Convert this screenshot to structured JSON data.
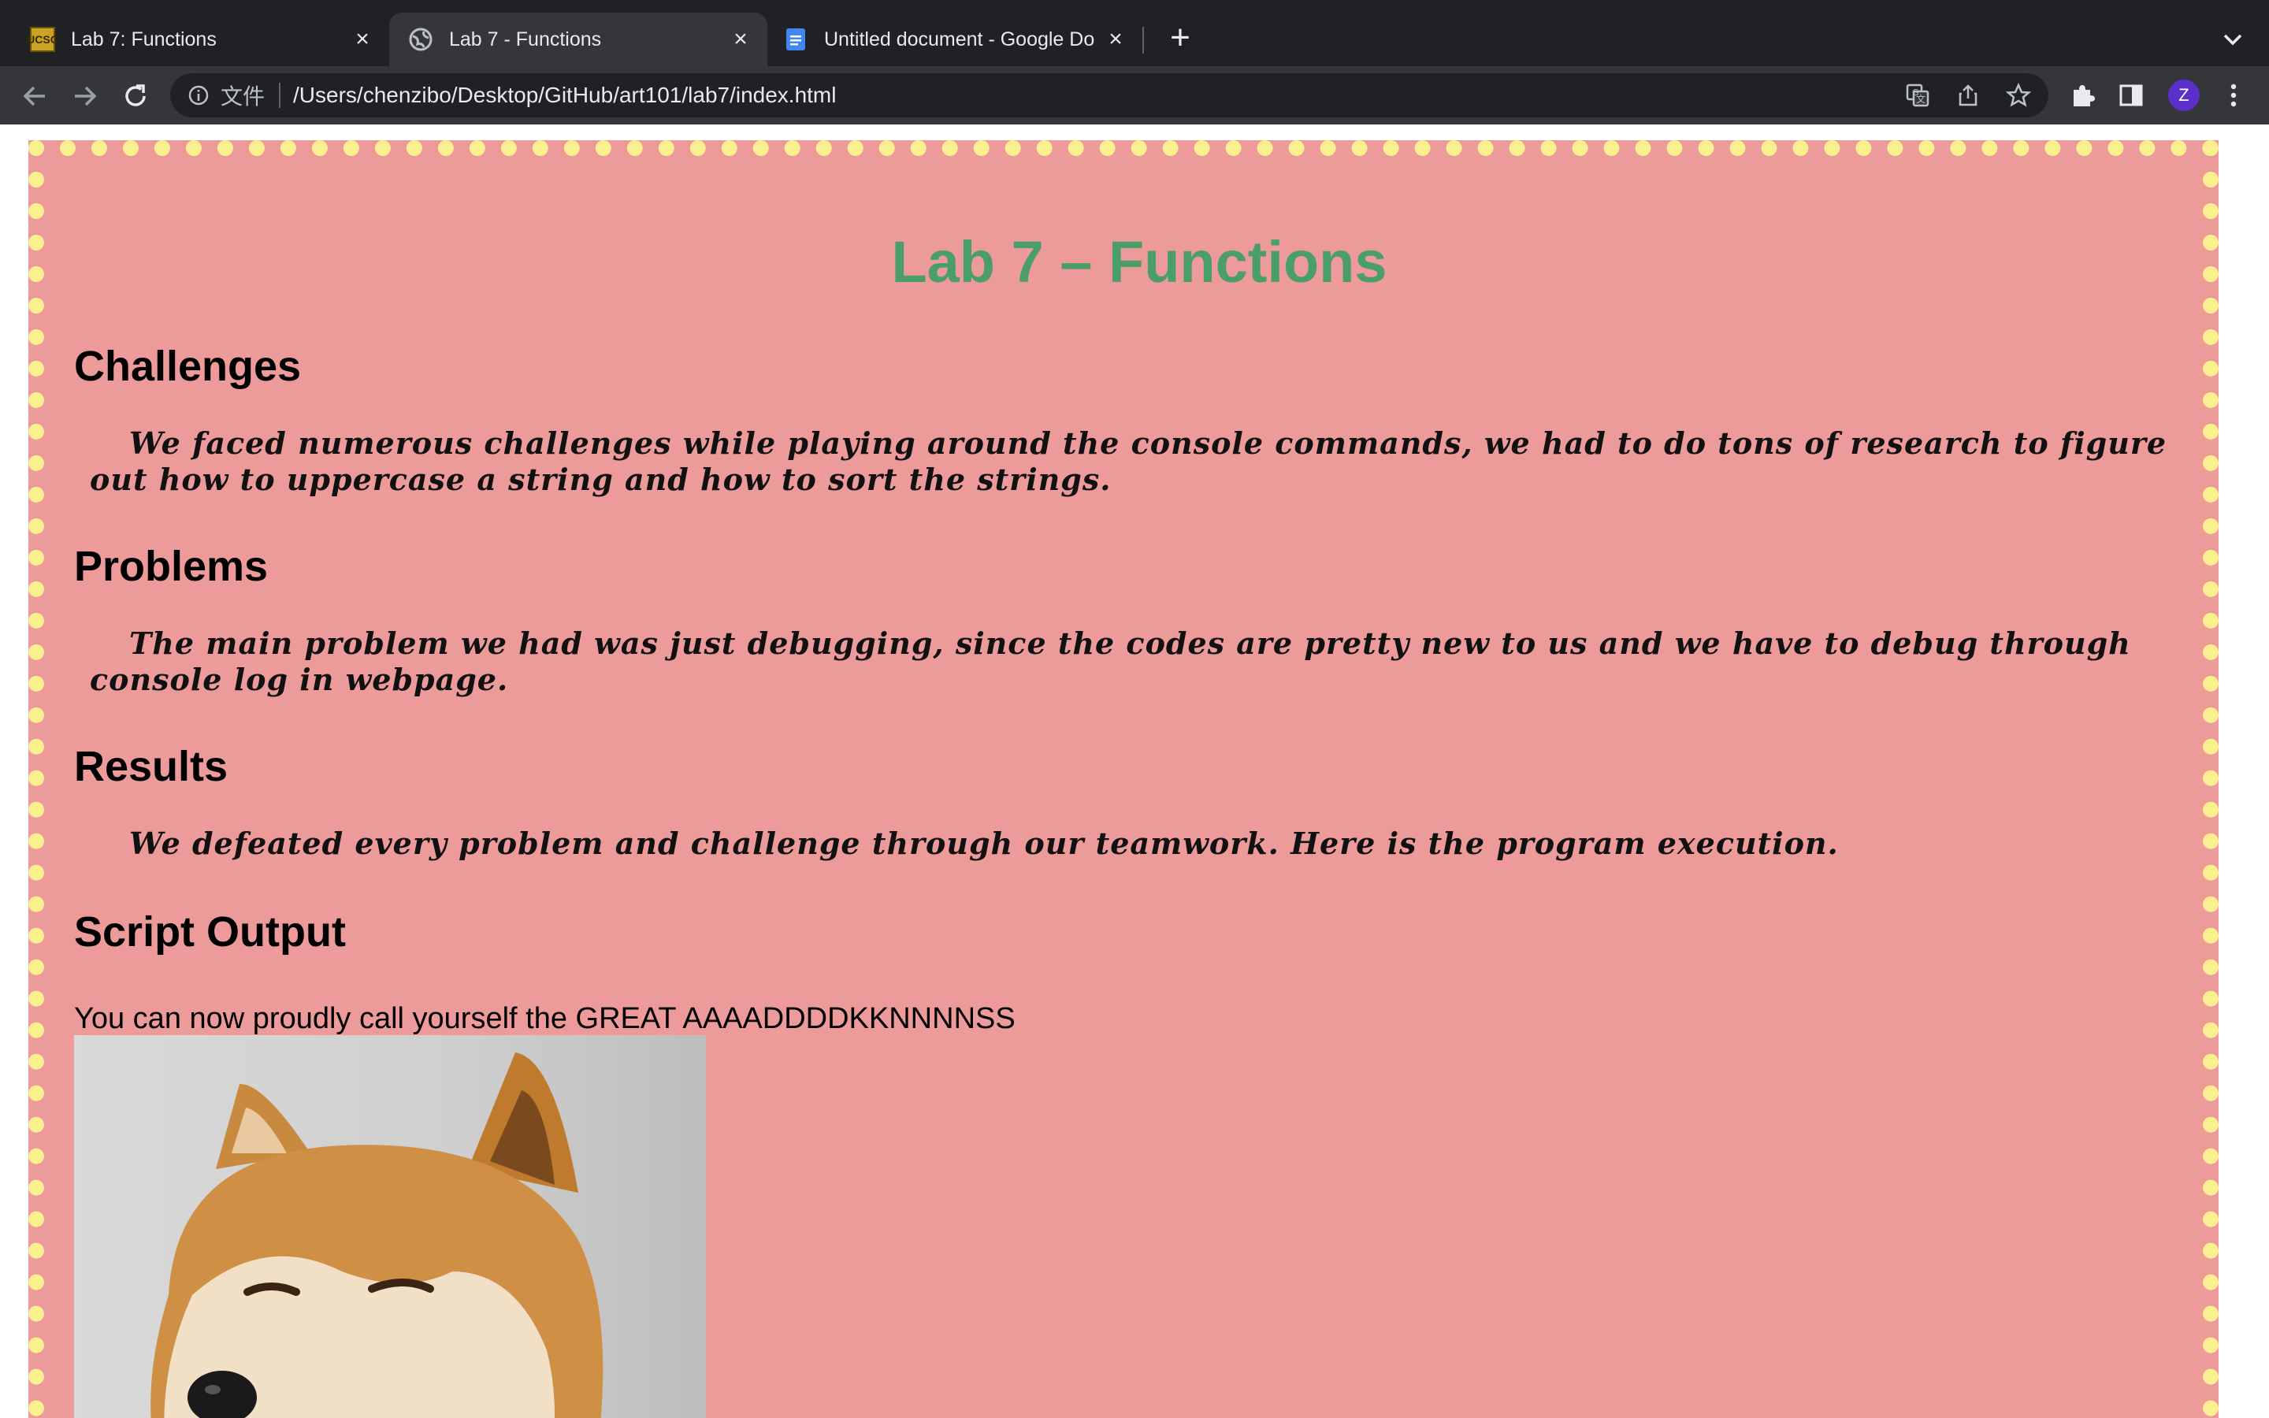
{
  "browser": {
    "tabs": [
      {
        "title": "Lab 7: Functions",
        "icon": "ucsc-favicon",
        "active": false
      },
      {
        "title": "Lab 7 - Functions",
        "icon": "globe-icon",
        "active": true
      },
      {
        "title": "Untitled document - Google Do",
        "icon": "google-docs-icon",
        "active": false
      }
    ],
    "address": {
      "scheme_label": "文件",
      "url": "/Users/chenzibo/Desktop/GitHub/art101/lab7/index.html"
    },
    "profile_initial": "Z"
  },
  "page": {
    "title": "Lab 7 – Functions",
    "sections": [
      {
        "heading": "Challenges",
        "text": "We faced numerous challenges while playing around the console commands, we had to do tons of research to figure out how to uppercase a string and how to sort the strings."
      },
      {
        "heading": "Problems",
        "text": "The main problem we had was just debugging, since the codes are pretty new to us and we have to debug through console log in webpage."
      },
      {
        "heading": "Results",
        "text": "We defeated every problem and challenge through our teamwork. Here is the program execution."
      }
    ],
    "output_heading": "Script Output",
    "output_text": "You can now proudly call yourself the GREAT AAAADDDDKKNNNNSS",
    "image_subject": "shiba-inu-doge"
  },
  "colors": {
    "background": "#ec9a9a",
    "border_dots": "#fbf08f",
    "title": "#4a9e68"
  }
}
